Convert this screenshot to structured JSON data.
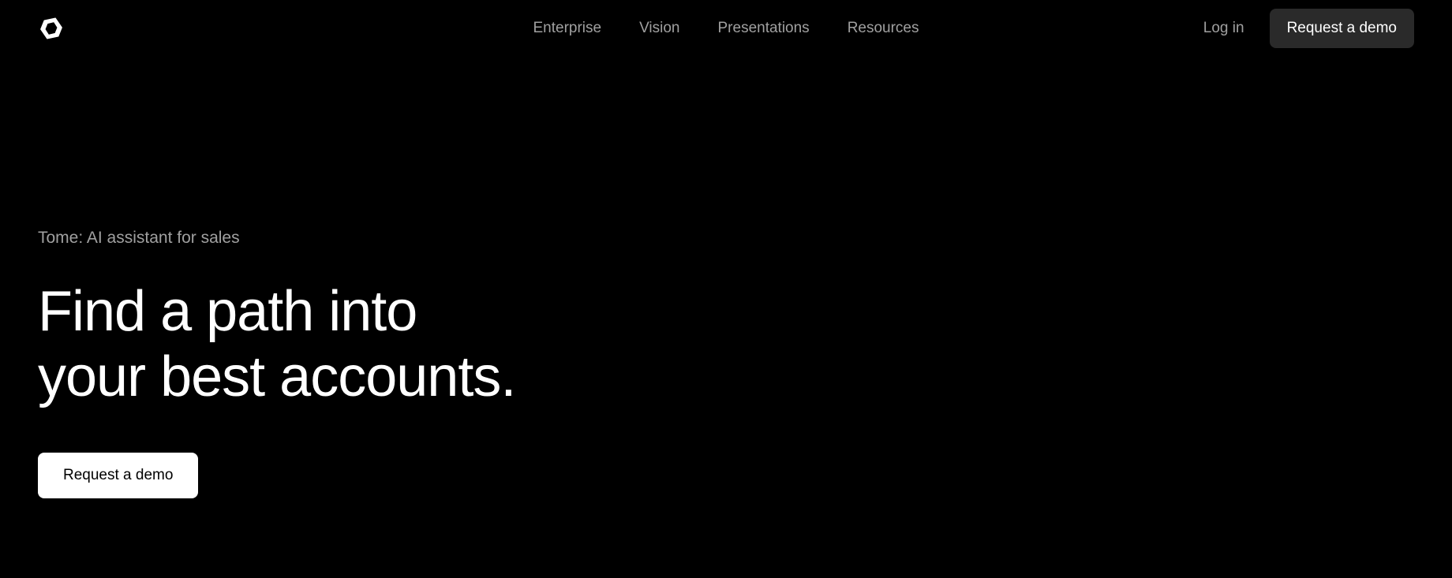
{
  "nav": {
    "items": [
      {
        "label": "Enterprise"
      },
      {
        "label": "Vision"
      },
      {
        "label": "Presentations"
      },
      {
        "label": "Resources"
      }
    ],
    "login": "Log in",
    "demo_button": "Request a demo"
  },
  "hero": {
    "subtitle": "Tome: AI assistant for sales",
    "title_line1": "Find a path into",
    "title_line2": "your best accounts.",
    "cta_button": "Request a demo"
  }
}
